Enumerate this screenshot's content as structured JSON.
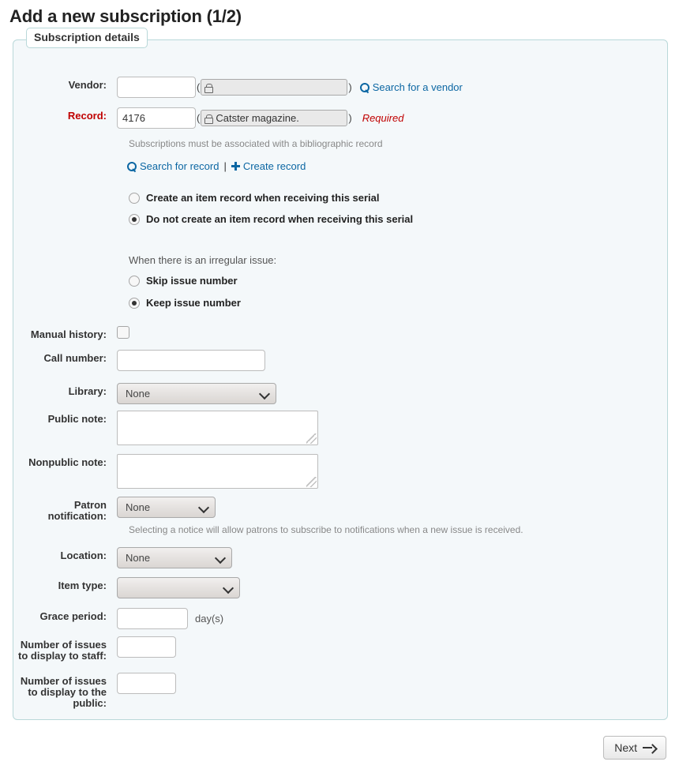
{
  "page": {
    "title": "Add a new subscription (1/2)"
  },
  "fieldset": {
    "legend": "Subscription details"
  },
  "fields": {
    "vendor": {
      "label": "Vendor:",
      "value": "",
      "readonly_value": "",
      "lock_icon": "lock-icon",
      "open_paren": "(",
      "close_paren": ")",
      "search_link": "Search for a vendor",
      "search_icon": "search-icon"
    },
    "record": {
      "label": "Record:",
      "value": "4176",
      "readonly_value": "Catster magazine.",
      "lock_icon": "lock-icon",
      "open_paren": "(",
      "close_paren": ")",
      "required_text": "Required",
      "hint": "Subscriptions must be associated with a bibliographic record",
      "search_link": "Search for record",
      "search_icon": "search-icon",
      "separator": "|",
      "create_link": "Create record",
      "create_icon": "plus-icon"
    },
    "item_record": {
      "option_create": "Create an item record when receiving this serial",
      "option_no_create": "Do not create an item record when receiving this serial",
      "selected": "no_create"
    },
    "irregular": {
      "prompt": "When there is an irregular issue:",
      "option_skip": "Skip issue number",
      "option_keep": "Keep issue number",
      "selected": "keep"
    },
    "manual_history": {
      "label": "Manual history:",
      "checked": false
    },
    "call_number": {
      "label": "Call number:",
      "value": ""
    },
    "library": {
      "label": "Library:",
      "value": "None",
      "chevron_icon": "chevron-down-icon"
    },
    "public_note": {
      "label": "Public note:",
      "value": ""
    },
    "nonpublic_note": {
      "label": "Nonpublic note:",
      "value": ""
    },
    "patron_notification": {
      "label_line1": "Patron",
      "label_line2": "notification:",
      "value": "None",
      "chevron_icon": "chevron-down-icon",
      "hint": "Selecting a notice will allow patrons to subscribe to notifications when a new issue is received."
    },
    "location": {
      "label": "Location:",
      "value": "None",
      "chevron_icon": "chevron-down-icon"
    },
    "item_type": {
      "label": "Item type:",
      "value": "",
      "chevron_icon": "chevron-down-icon"
    },
    "grace_period": {
      "label": "Grace period:",
      "value": "",
      "suffix": "day(s)"
    },
    "issues_staff": {
      "label_line1": "Number of issues",
      "label_line2": "to display to staff:",
      "value": ""
    },
    "issues_public": {
      "label_line1": "Number of issues",
      "label_line2": "to display to the",
      "label_line3": "public:",
      "value": ""
    }
  },
  "actions": {
    "next_label": "Next",
    "next_icon": "arrow-right-icon"
  },
  "colors": {
    "link": "#0c67a3",
    "required": "#c00000",
    "fieldset_bg": "#f4f8fa",
    "fieldset_border": "#b9d8d9"
  }
}
